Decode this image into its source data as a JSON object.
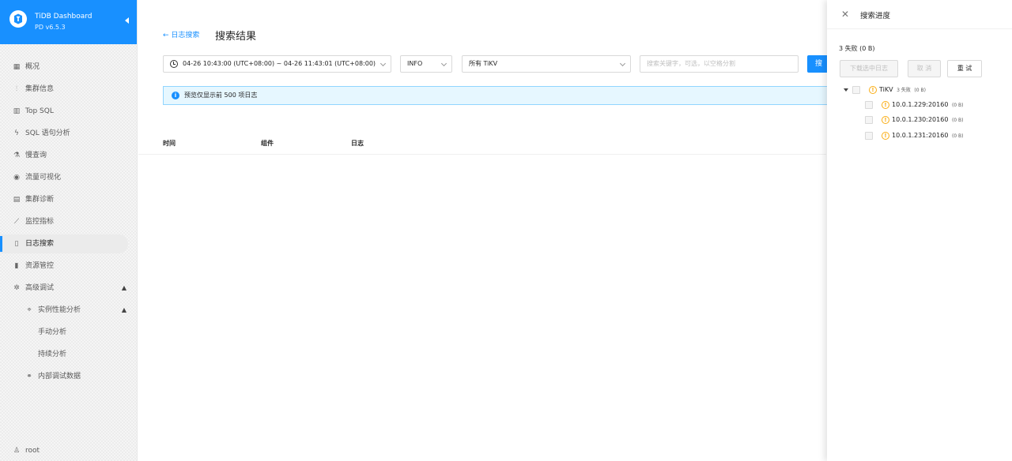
{
  "app": {
    "title": "TiDB Dashboard",
    "version": "PD v6.5.3",
    "accent": "#1890ff"
  },
  "sidebar": {
    "items": [
      {
        "label": "概况",
        "icon": "dashboard-icon"
      },
      {
        "label": "集群信息",
        "icon": "cluster-icon"
      },
      {
        "label": "Top SQL",
        "icon": "chart-icon"
      },
      {
        "label": "SQL 语句分析",
        "icon": "bolt-icon"
      },
      {
        "label": "慢查询",
        "icon": "experiment-icon"
      },
      {
        "label": "流量可视化",
        "icon": "eye-icon"
      },
      {
        "label": "集群诊断",
        "icon": "file-icon"
      },
      {
        "label": "监控指标",
        "icon": "line-chart-icon"
      },
      {
        "label": "日志搜索",
        "icon": "file-search-icon",
        "active": true
      },
      {
        "label": "资源管控",
        "icon": "book-icon"
      },
      {
        "label": "高级调试",
        "icon": "bug-icon",
        "expanded": true
      },
      {
        "label": "实例性能分析",
        "icon": "aim-icon",
        "expanded": true
      },
      {
        "label": "手动分析"
      },
      {
        "label": "持续分析"
      },
      {
        "label": "内部调试数据",
        "icon": "link-icon"
      }
    ],
    "user": "root"
  },
  "main": {
    "back_label": "← 日志搜索",
    "title": "搜索结果",
    "time_range": "04-26 10:43:00 (UTC+08:00) ~ 04-26 11:43:01 (UTC+08:00)",
    "level": "INFO",
    "components": "所有 TiKV",
    "search_placeholder": "搜索关键字，可选，以空格分割",
    "search_button": "搜",
    "alert": "预览仅显示前 500 项日志",
    "columns": [
      "时间",
      "组件",
      "日志"
    ]
  },
  "drawer": {
    "title": "搜索进度",
    "summary": "3 失败 (0 B)",
    "buttons": {
      "download": "下载选中日志",
      "cancel": "取 消",
      "retry": "重 试"
    },
    "tree": {
      "root": {
        "label": "TiKV",
        "status": "3 失败",
        "size": "(0 B)"
      },
      "children": [
        {
          "label": "10.0.1.229:20160",
          "size": "(0 B)"
        },
        {
          "label": "10.0.1.230:20160",
          "size": "(0 B)"
        },
        {
          "label": "10.0.1.231:20160",
          "size": "(0 B)"
        }
      ]
    }
  }
}
